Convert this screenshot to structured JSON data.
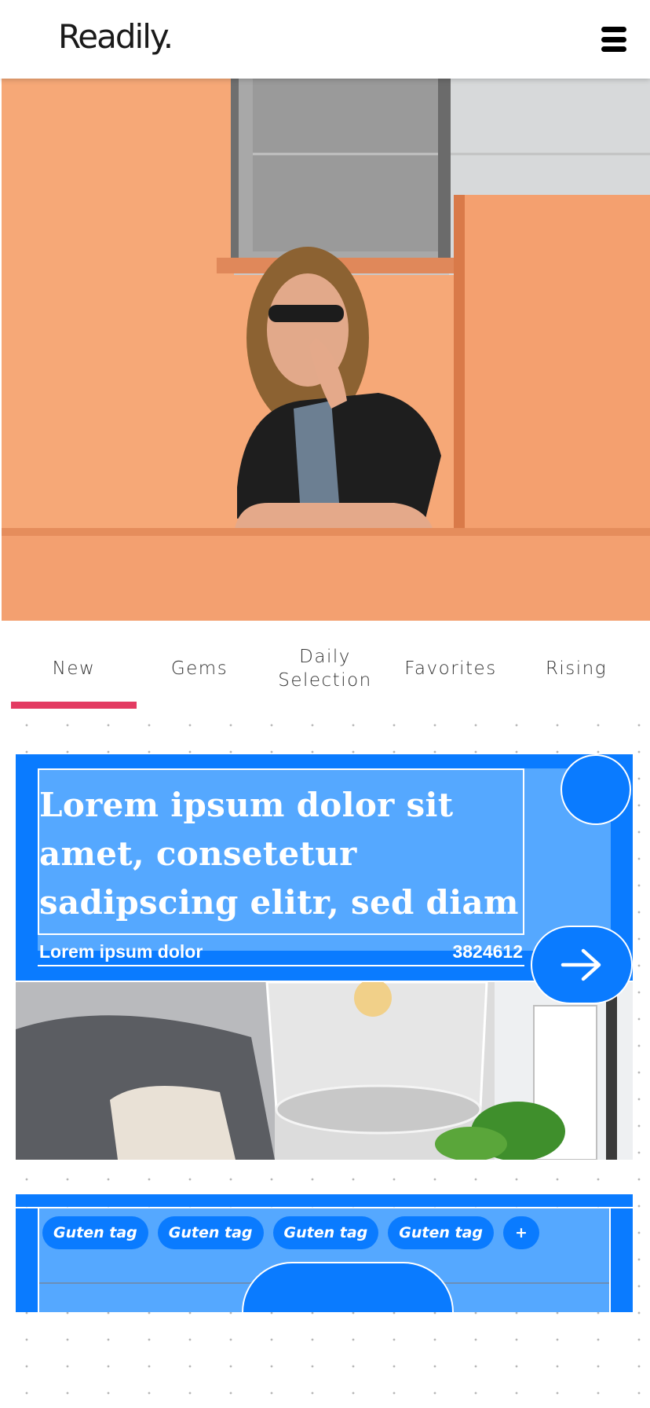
{
  "header": {
    "logo_text": "Readily.",
    "menu_icon": "hamburger-menu-icon"
  },
  "hero": {
    "image": "woman-on-orange-balcony-photo",
    "colors": {
      "wall": "#f6a877",
      "shadow": "#e38a56"
    }
  },
  "tabs": [
    {
      "label": "New",
      "active": true
    },
    {
      "label": "Gems",
      "active": false
    },
    {
      "label": "Daily\nSelection",
      "active": false
    },
    {
      "label": "Favorites",
      "active": false
    },
    {
      "label": "Rising",
      "active": false
    }
  ],
  "card": {
    "title": "Lorem ipsum dolor sit amet, consetetur sadipscing elitr, sed diam",
    "author": "Lorem ipsum dolor",
    "count": "3824612",
    "arrow_icon": "arrow-right-icon",
    "image": "pendant-lamp-interior-photo",
    "tags": [
      "Guten tag",
      "Guten tag",
      "Guten tag",
      "Guten tag"
    ],
    "add_tag_label": "+"
  },
  "colors": {
    "accent": "#e33b62",
    "card_blue": "#0a7bff",
    "card_light_blue": "#55a8ff"
  }
}
